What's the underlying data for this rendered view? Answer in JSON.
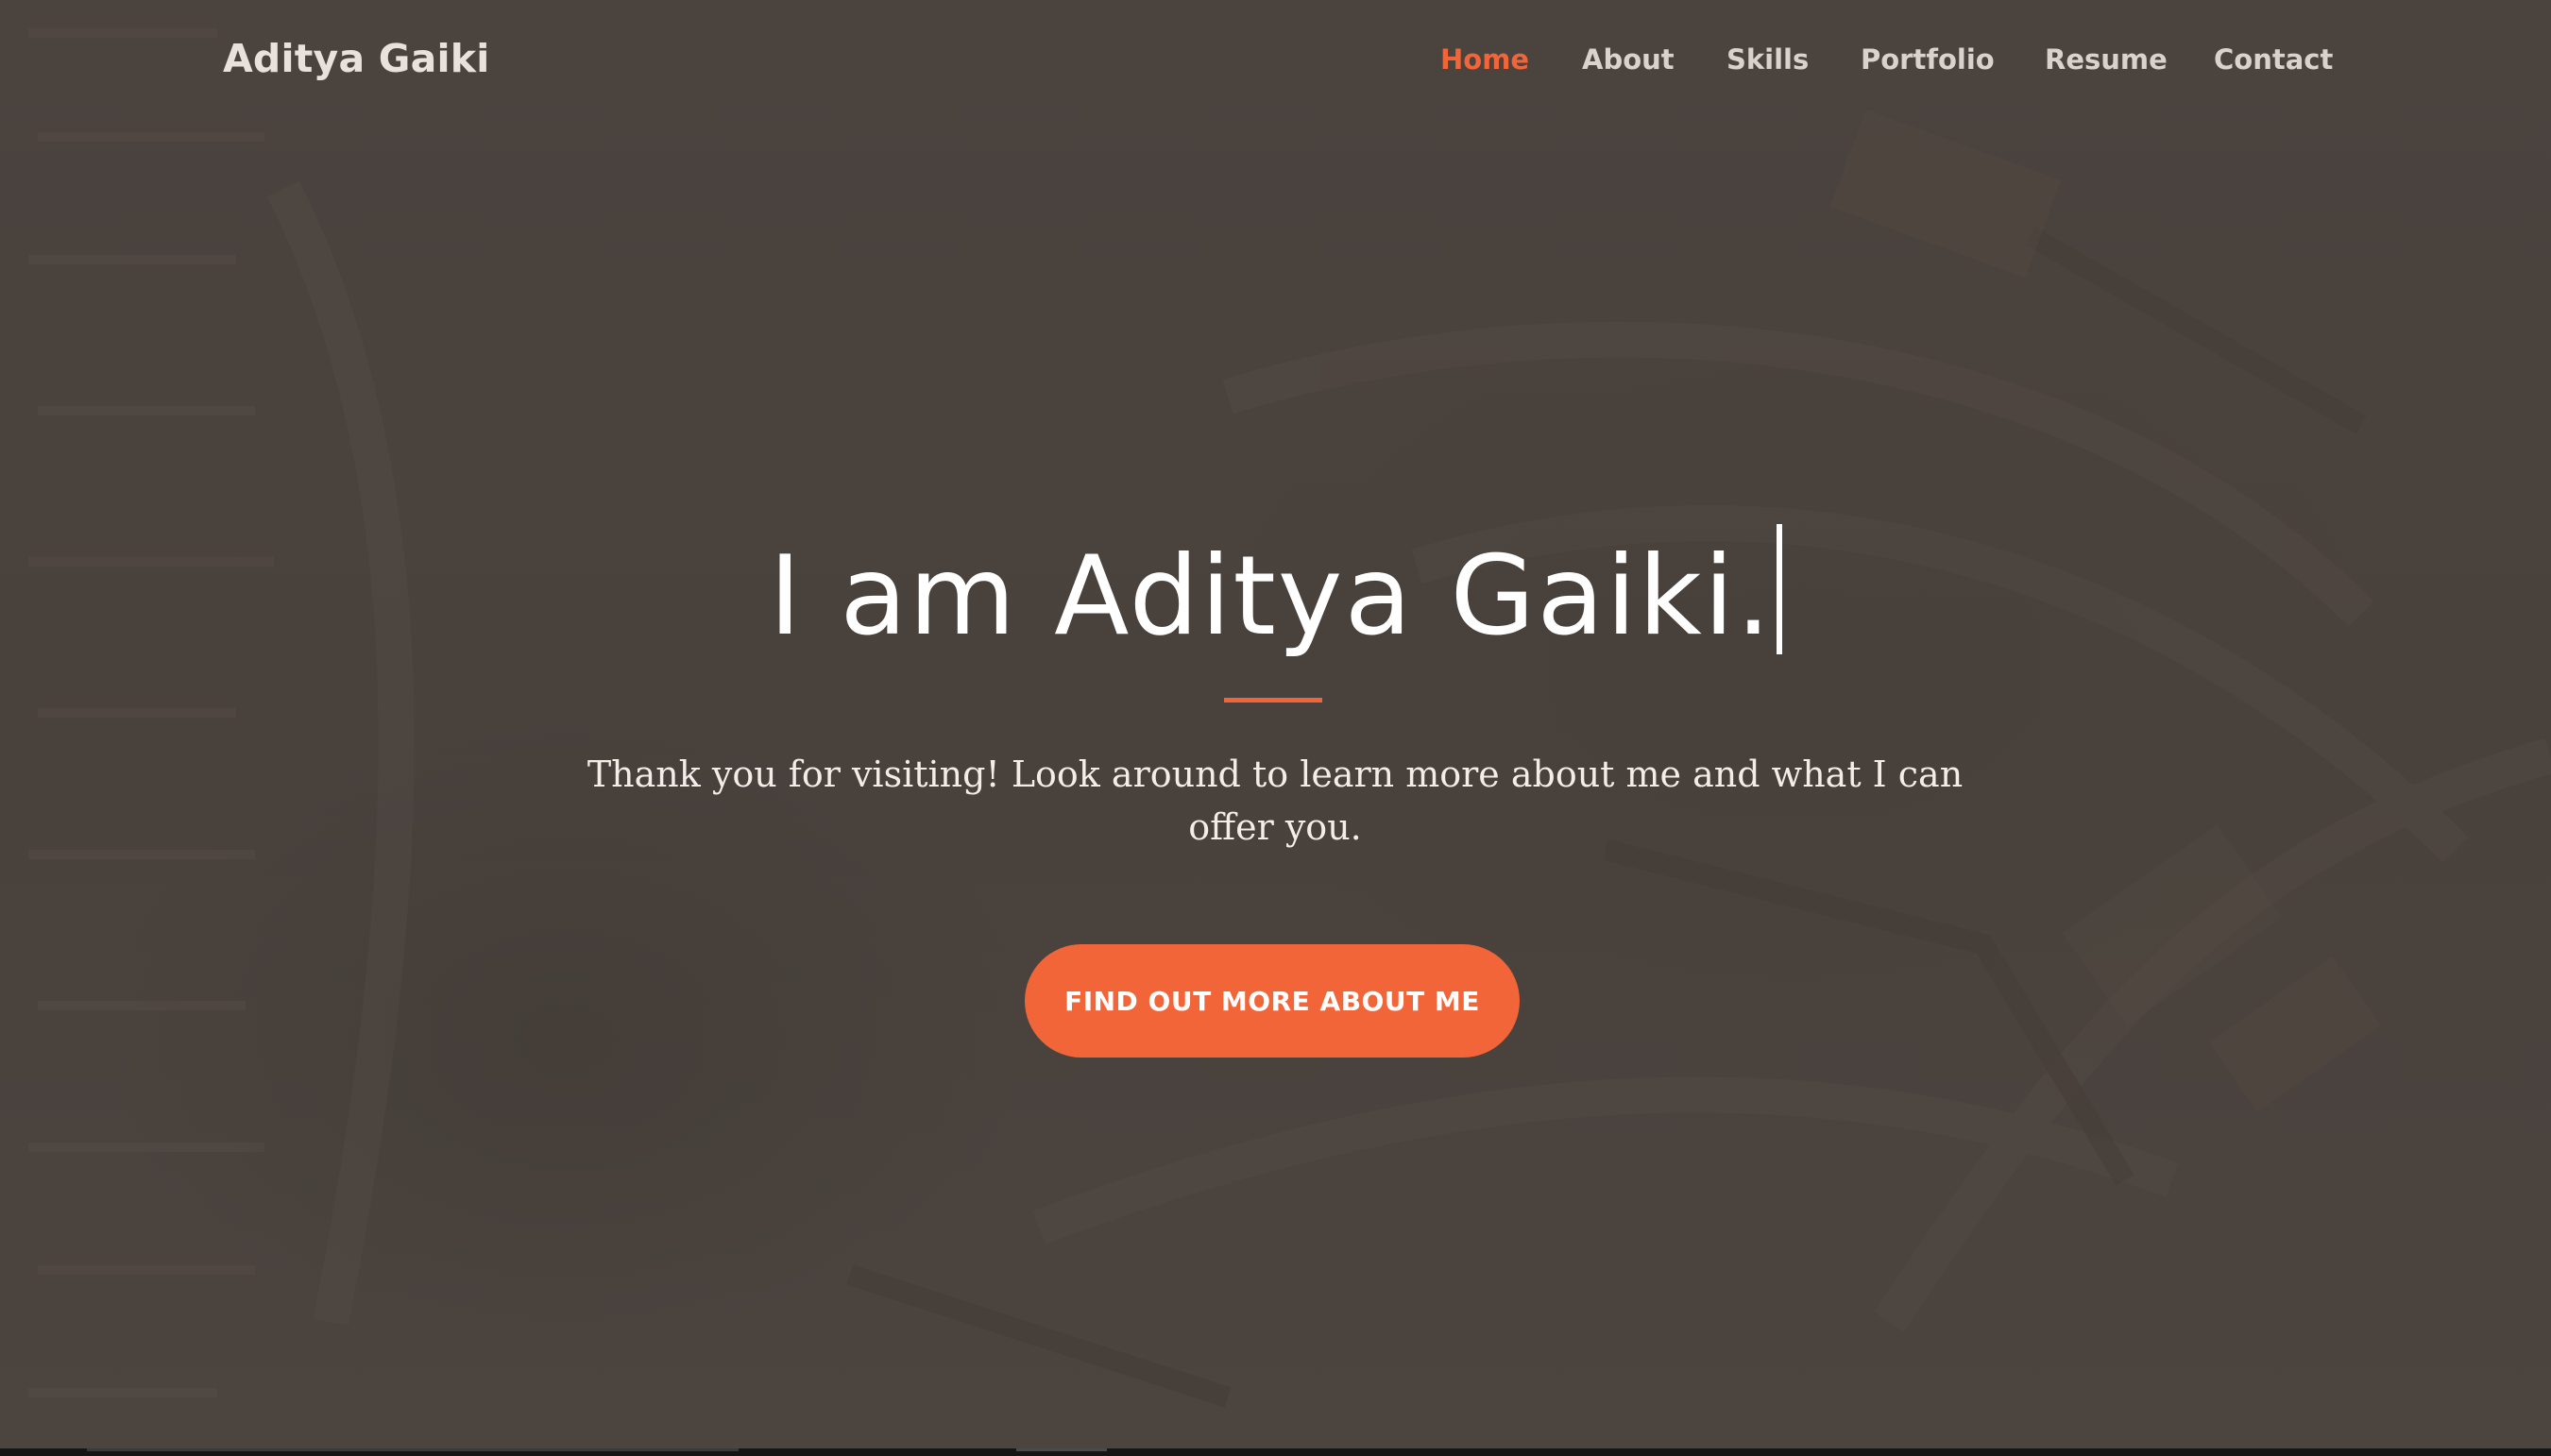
{
  "brand": {
    "name": "Aditya Gaiki"
  },
  "nav": {
    "items": [
      {
        "label": "Home",
        "active": true
      },
      {
        "label": "About",
        "active": false
      },
      {
        "label": "Skills",
        "active": false
      },
      {
        "label": "Portfolio",
        "active": false
      },
      {
        "label": "Resume",
        "active": false
      },
      {
        "label": "Contact",
        "active": false
      }
    ]
  },
  "hero": {
    "title": "I am Aditya Gaiki.",
    "tagline": "Thank you for visiting! Look around to learn more about me and what I can offer you.",
    "cta_label": "FIND OUT MORE ABOUT ME"
  },
  "colors": {
    "accent": "#f26539",
    "background": "#4a423d",
    "text": "#ffffff"
  }
}
